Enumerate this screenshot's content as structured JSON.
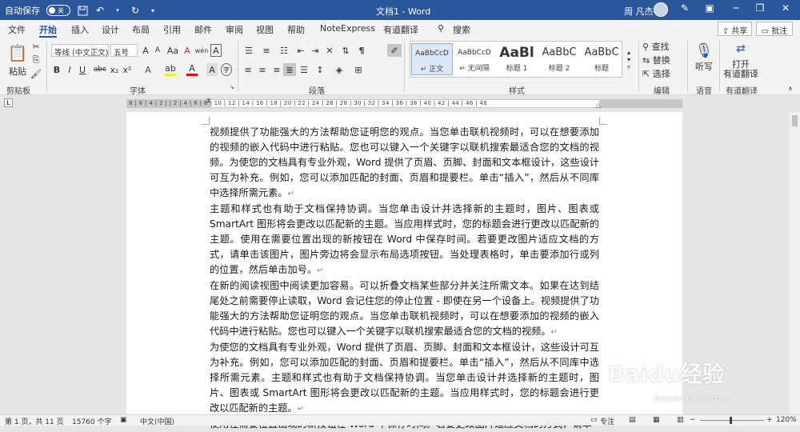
{
  "titlebar": {
    "autosave_label": "自动保存",
    "autosave_state": "关",
    "doc_title": "文档1  -  Word",
    "user_name": "周 凡杰"
  },
  "menu": {
    "tabs": [
      "文件",
      "开始",
      "插入",
      "设计",
      "布局",
      "引用",
      "邮件",
      "审阅",
      "视图",
      "帮助",
      "NoteExpress",
      "有道翻译"
    ],
    "active": "开始",
    "search": "搜索",
    "share": "共享",
    "comment": "批注"
  },
  "ribbon": {
    "clipboard": {
      "label": "剪贴板",
      "paste": "粘贴"
    },
    "font": {
      "label": "字体",
      "font_name": "等线 (中文正文)",
      "font_size": "五号",
      "size_up": "A",
      "size_down": "A",
      "case": "Aa",
      "clear": "A",
      "pinyin": "wén",
      "border_a": "A",
      "bold": "B",
      "italic": "I",
      "underline": "U",
      "strike": "abc",
      "sub": "x₂",
      "sup": "x²",
      "effects": "A",
      "highlight": "ab",
      "color": "A",
      "char_shade": "A",
      "enclose": "字"
    },
    "paragraph": {
      "label": "段落"
    },
    "styles": {
      "label": "样式",
      "items": [
        {
          "preview": "AaBbCcD",
          "name": "↵ 正文"
        },
        {
          "preview": "AaBbCcD",
          "name": "↵ 无间隔"
        },
        {
          "preview": "AaBl",
          "name": "标题 1"
        },
        {
          "preview": "AaBbC",
          "name": "标题 2"
        },
        {
          "preview": "AaBbC",
          "name": "标题"
        }
      ]
    },
    "editing": {
      "label": "编辑",
      "find": "查找",
      "replace": "替换",
      "select": "选择"
    },
    "voice": {
      "label": "语音",
      "dictate": "听写"
    },
    "youdao": {
      "label": "有道翻译",
      "open": "打开",
      "open2": "有道翻译"
    }
  },
  "ruler": {
    "numbers": "8 | 6 | 4 | 2 |     | 2 | 4 | 6 | 8 | 10 | 12 | 14 | 16 | 18 | 20 | 22 | 24 | 26 | 28 | 30 | 32 | 34 | 36 | 38 | 40 | 42 | 44 | 46 | 48"
  },
  "document": {
    "paragraphs": [
      "视频提供了功能强大的方法帮助您证明您的观点。当您单击联机视频时，可以在想要添加的视频的嵌入代码中进行粘贴。您也可以键入一个关键字以联机搜索最适合您的文档的视频。为使您的文档具有专业外观，Word 提供了页眉、页脚、封面和文本框设计，这些设计可互为补充。例如，您可以添加匹配的封面、页眉和提要栏。单击“插入”，然后从不同库中选择所需元素。",
      "主题和样式也有助于文档保持协调。当您单击设计并选择新的主题时，图片、图表或 SmartArt 图形将会更改以匹配新的主题。当应用样式时，您的标题会进行更改以匹配新的主题。使用在需要位置出现的新按钮在 Word 中保存时间。若要更改图片适应文档的方式，请单击该图片，图片旁边将会显示布局选项按钮。当处理表格时，单击要添加行或列的位置，然后单击加号。",
      "在新的阅读视图中阅读更加容易。可以折叠文档某些部分并关注所需文本。如果在达到结尾处之前需要停止读取，Word 会记住您的停止位置 - 即使在另一个设备上。视频提供了功能强大的方法帮助您证明您的观点。当您单击联机视频时，可以在想要添加的视频的嵌入代码中进行粘贴。您也可以键入一个关键字以联机搜索最适合您的文档的视频。",
      "为使您的文档具有专业外观，Word 提供了页眉、页脚、封面和文本框设计，这些设计可互为补充。例如，您可以添加匹配的封面、页眉和提要栏。单击“插入”，然后从不同库中选择所需元素。主题和样式也有助于文档保持协调。当您单击设计并选择新的主题时，图片、图表或 SmartArt 图形将会更改以匹配新的主题。当应用样式时，您的标题会进行更改以匹配新的主题。",
      "使用在需要位置出现的新按钮在 Word 中保存时间。若要更改图片适应文档的方式，请单"
    ]
  },
  "status": {
    "page": "第 1 页，共 11 页",
    "words": "15760 个字",
    "lang": "中文(中国)",
    "focus": "专注",
    "zoom": "120%"
  },
  "watermark": {
    "brand": "Baidu经验",
    "url": "jingyan.baidu.com"
  }
}
